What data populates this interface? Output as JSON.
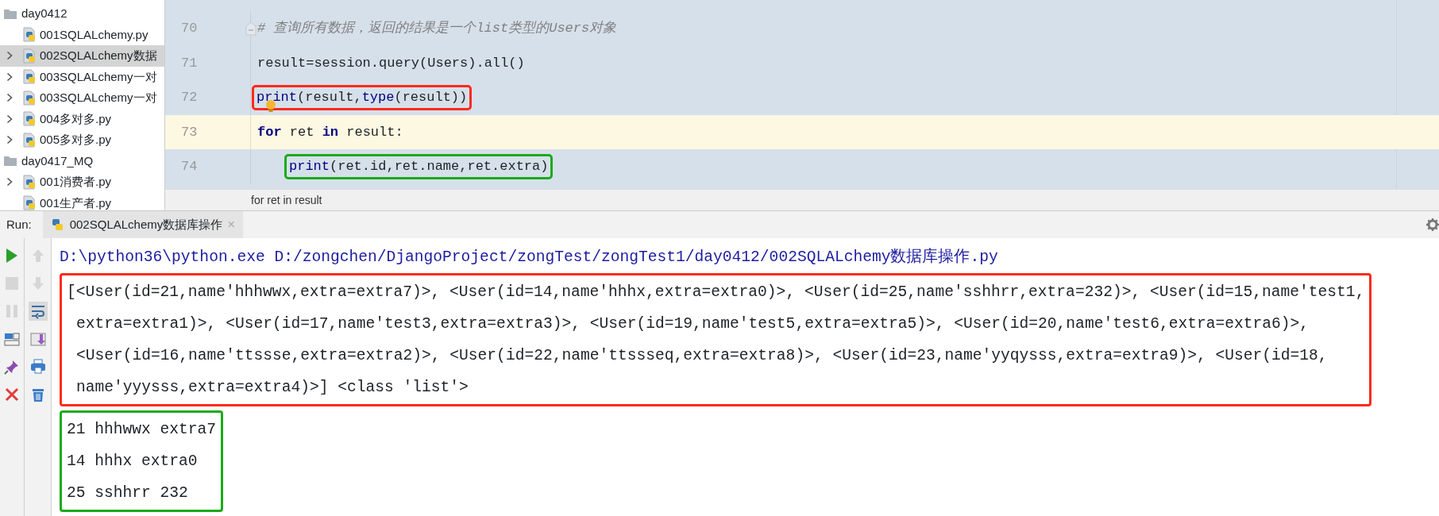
{
  "project_tree": [
    {
      "label": "day0412",
      "kind": "folder",
      "children": [
        {
          "label": "001SQLALchemy.py",
          "kind": "python",
          "expandable": false,
          "selected": false
        },
        {
          "label": "002SQLALchemy数据",
          "kind": "python",
          "expandable": true,
          "selected": true
        },
        {
          "label": "003SQLALchemy一对",
          "kind": "python",
          "expandable": true,
          "selected": false
        },
        {
          "label": "003SQLALchemy一对",
          "kind": "python",
          "expandable": true,
          "selected": false
        },
        {
          "label": "004多对多.py",
          "kind": "python",
          "expandable": true,
          "selected": false
        },
        {
          "label": "005多对多.py",
          "kind": "python",
          "expandable": true,
          "selected": false
        }
      ]
    },
    {
      "label": "day0417_MQ",
      "kind": "folder",
      "children": [
        {
          "label": "001消费者.py",
          "kind": "python",
          "expandable": true,
          "selected": false
        },
        {
          "label": "001生产者.py",
          "kind": "python",
          "expandable": false,
          "selected": false
        }
      ]
    }
  ],
  "editor": {
    "lines": [
      {
        "number": "70",
        "current": false,
        "fold": true,
        "tokens": [
          {
            "kind": "comment",
            "text": "# 查询所有数据，返回的结果是一个list类型的Users对象"
          }
        ]
      },
      {
        "number": "71",
        "current": false,
        "fold": false,
        "tokens": [
          {
            "kind": "plain",
            "text": "result=session.query(Users).all()"
          }
        ]
      },
      {
        "number": "72",
        "current": false,
        "fold": false,
        "color": "#ff2a1a",
        "lightbulb": true,
        "tokens": [
          {
            "kind": "builtin",
            "text": "print"
          },
          {
            "kind": "plain",
            "text": "(result,"
          },
          {
            "kind": "builtin",
            "text": "type"
          },
          {
            "kind": "plain",
            "text": "(result))"
          }
        ]
      },
      {
        "number": "73",
        "current": true,
        "fold": false,
        "tokens": [
          {
            "kind": "keyword",
            "text": "for"
          },
          {
            "kind": "plain",
            "text": " ret "
          },
          {
            "kind": "keyword",
            "text": "in"
          },
          {
            "kind": "plain",
            "text": " result:"
          }
        ],
        "children": [
          {
            "number": "74",
            "current": false,
            "fold": false,
            "color": "#1aab1a",
            "tokens": [
              {
                "kind": "builtin",
                "text": "print"
              },
              {
                "kind": "plain",
                "text": "(ret.id,ret.name,ret.extra)"
              }
            ]
          }
        ]
      }
    ],
    "breadcrumb": "for ret in result"
  },
  "run_panel": {
    "label": "Run:",
    "tab": {
      "title": "002SQLALchemy数据库操作",
      "close": "×"
    },
    "toolbar_left": [
      {
        "kind": "run",
        "disabled": false
      },
      {
        "kind": "stop",
        "disabled": true
      },
      {
        "kind": "pause",
        "disabled": true
      },
      {
        "kind": "layout",
        "disabled": false
      },
      {
        "kind": "pin",
        "disabled": false
      },
      {
        "kind": "close",
        "disabled": false
      }
    ],
    "toolbar_right": [
      {
        "kind": "up",
        "disabled": true,
        "on": false
      },
      {
        "kind": "down",
        "disabled": true,
        "on": false
      },
      {
        "kind": "wrap",
        "disabled": false,
        "on": true
      },
      {
        "kind": "scroll",
        "disabled": false,
        "on": false
      },
      {
        "kind": "print",
        "disabled": false,
        "on": false
      },
      {
        "kind": "trash",
        "disabled": false,
        "on": false
      }
    ],
    "command": "D:\\python36\\python.exe D:/zongchen/DjangoProject/zongTest/zongTest1/day0412/002SQLALchemy数据库操作.py",
    "output_groups": [
      {
        "color": "#ff2a1a",
        "lines": [
          {
            "text": "[<User(id=21,name'hhhwwx,extra=extra7)>, <User(id=14,name'hhhx,extra=extra0)>, <User(id=25,name'sshhrr,extra=232)>, <User(id=15,name'test1,",
            "wrapped": false
          },
          {
            "text": "extra=extra1)>, <User(id=17,name'test3,extra=extra3)>, <User(id=19,name'test5,extra=extra5)>, <User(id=20,name'test6,extra=extra6)>,",
            "wrapped": true
          },
          {
            "text": "<User(id=16,name'ttssse,extra=extra2)>, <User(id=22,name'ttssseq,extra=extra8)>, <User(id=23,name'yyqysss,extra=extra9)>, <User(id=18,",
            "wrapped": true
          },
          {
            "text": "name'yyysss,extra=extra4)>] <class 'list'>",
            "wrapped": true
          }
        ]
      },
      {
        "color": "#1aab1a",
        "lines": [
          {
            "text": "21 hhhwwx extra7",
            "wrapped": false
          },
          {
            "text": "14 hhhx extra0",
            "wrapped": false
          },
          {
            "text": "25 sshhrr 232",
            "wrapped": false
          }
        ]
      }
    ]
  }
}
